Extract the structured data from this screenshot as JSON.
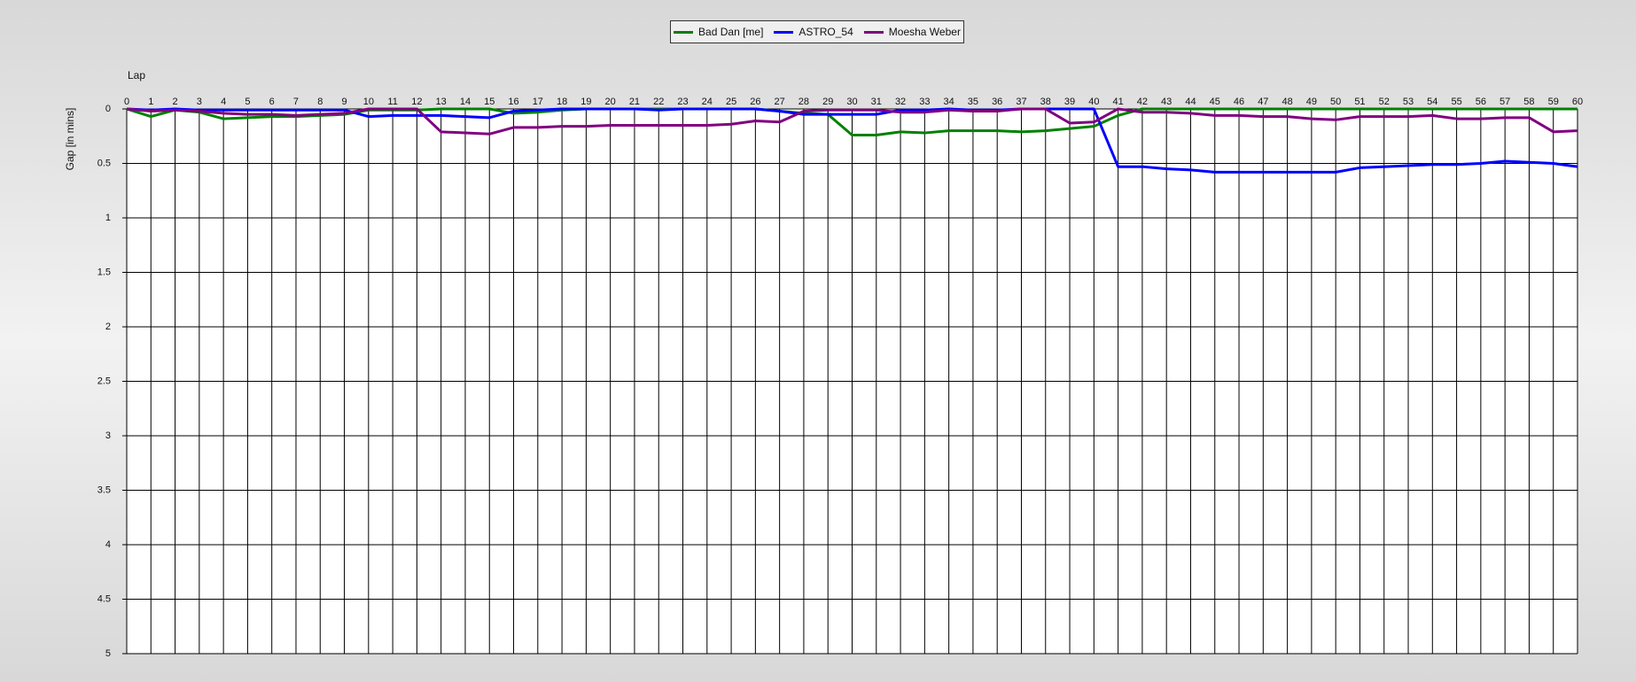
{
  "chart_data": {
    "type": "line",
    "title": "",
    "xlabel": "Lap",
    "ylabel": "Gap [in mins]",
    "x_axis_position": "top",
    "y_axis_inverted": true,
    "grid": true,
    "legend_position": "top-center",
    "xlim": [
      0,
      60
    ],
    "ylim": [
      0,
      5
    ],
    "x_ticks": [
      0,
      1,
      2,
      3,
      4,
      5,
      6,
      7,
      8,
      9,
      10,
      11,
      12,
      13,
      14,
      15,
      16,
      17,
      18,
      19,
      20,
      21,
      22,
      23,
      24,
      25,
      26,
      27,
      28,
      29,
      30,
      31,
      32,
      33,
      34,
      35,
      36,
      37,
      38,
      39,
      40,
      41,
      42,
      43,
      44,
      45,
      46,
      47,
      48,
      49,
      50,
      51,
      52,
      53,
      54,
      55,
      56,
      57,
      58,
      59,
      60
    ],
    "y_ticks": [
      0,
      0.5,
      1,
      1.5,
      2,
      2.5,
      3,
      3.5,
      4,
      4.5,
      5
    ],
    "y_tick_labels": [
      "0",
      "0.5",
      "1",
      "1.5",
      "2",
      "2.5",
      "3",
      "3.5",
      "4",
      "4.5",
      "5"
    ],
    "x": [
      0,
      1,
      2,
      3,
      4,
      5,
      6,
      7,
      8,
      9,
      10,
      11,
      12,
      13,
      14,
      15,
      16,
      17,
      18,
      19,
      20,
      21,
      22,
      23,
      24,
      25,
      26,
      27,
      28,
      29,
      30,
      31,
      32,
      33,
      34,
      35,
      36,
      37,
      38,
      39,
      40,
      41,
      42,
      43,
      44,
      45,
      46,
      47,
      48,
      49,
      50,
      51,
      52,
      53,
      54,
      55,
      56,
      57,
      58,
      59,
      60
    ],
    "series": [
      {
        "name": "Bad Dan [me]",
        "color": "#008000",
        "values": [
          0,
          0.07,
          0.01,
          0.03,
          0.09,
          0.08,
          0.07,
          0.07,
          0.06,
          0.05,
          0.01,
          0.01,
          0.01,
          0.0,
          0.0,
          0.0,
          0.04,
          0.03,
          0.01,
          0.0,
          0.0,
          0.0,
          0.0,
          0.0,
          0.0,
          0.0,
          0.0,
          0.02,
          0.04,
          0.05,
          0.24,
          0.24,
          0.21,
          0.22,
          0.2,
          0.2,
          0.2,
          0.21,
          0.2,
          0.18,
          0.16,
          0.06,
          0.0,
          0.0,
          0.0,
          0.0,
          0.0,
          0.0,
          0.0,
          0.0,
          0.0,
          0.0,
          0.0,
          0.0,
          0.0,
          0.0,
          0.0,
          0.0,
          0.0,
          0.0,
          0.0
        ]
      },
      {
        "name": "ASTRO_54",
        "color": "#0000ff",
        "values": [
          0,
          0.01,
          0.0,
          0.01,
          0.01,
          0.01,
          0.01,
          0.01,
          0.01,
          0.01,
          0.07,
          0.06,
          0.06,
          0.06,
          0.07,
          0.08,
          0.02,
          0.01,
          0.0,
          0.0,
          0.0,
          0.0,
          0.01,
          0.0,
          0.0,
          0.0,
          0.0,
          0.02,
          0.05,
          0.05,
          0.05,
          0.05,
          0.01,
          0.01,
          0.0,
          0.01,
          0.01,
          0.0,
          0.0,
          0.0,
          0.0,
          0.53,
          0.53,
          0.55,
          0.56,
          0.58,
          0.58,
          0.58,
          0.58,
          0.58,
          0.58,
          0.54,
          0.53,
          0.52,
          0.51,
          0.51,
          0.5,
          0.48,
          0.49,
          0.5,
          0.53
        ]
      },
      {
        "name": "Moesha Weber",
        "color": "#800080",
        "values": [
          0,
          0.02,
          0.01,
          0.02,
          0.04,
          0.05,
          0.05,
          0.06,
          0.05,
          0.04,
          0.0,
          0.0,
          0.0,
          0.21,
          0.22,
          0.23,
          0.17,
          0.17,
          0.16,
          0.16,
          0.15,
          0.15,
          0.15,
          0.15,
          0.15,
          0.14,
          0.11,
          0.12,
          0.02,
          0.01,
          0.01,
          0.01,
          0.03,
          0.03,
          0.01,
          0.02,
          0.02,
          0.0,
          0.0,
          0.13,
          0.12,
          0.0,
          0.03,
          0.03,
          0.04,
          0.06,
          0.06,
          0.07,
          0.07,
          0.09,
          0.1,
          0.07,
          0.07,
          0.07,
          0.06,
          0.09,
          0.09,
          0.08,
          0.08,
          0.21,
          0.2
        ]
      }
    ]
  }
}
